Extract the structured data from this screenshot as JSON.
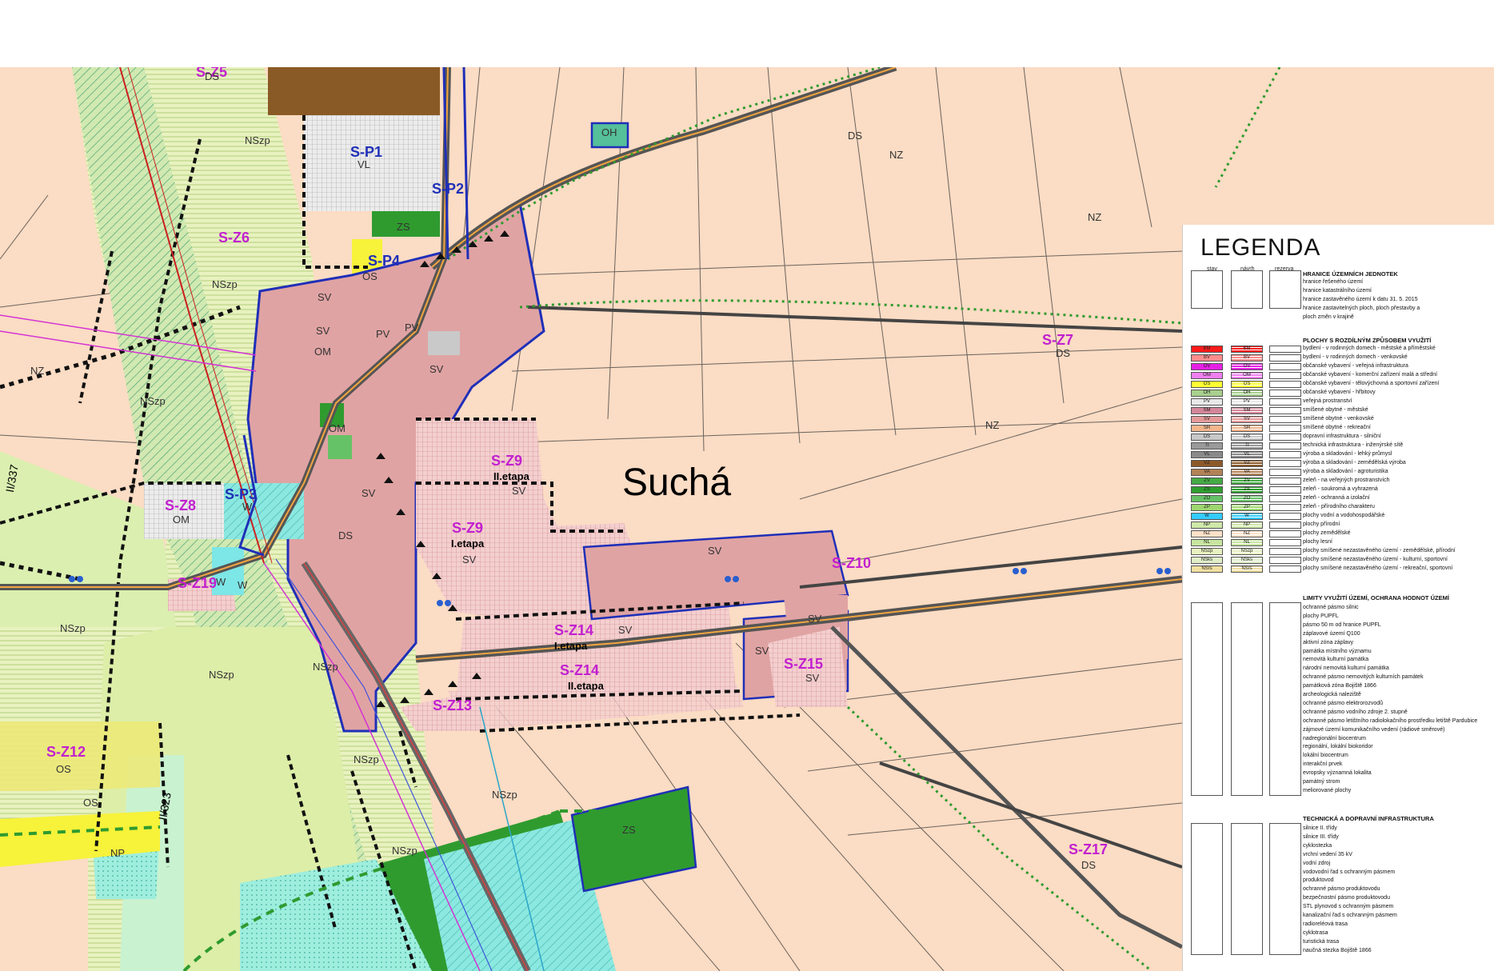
{
  "map": {
    "village_name": "Suchá",
    "zone_labels": [
      {
        "id": "s-z5",
        "text": "S-Z5",
        "style": "zone-id"
      },
      {
        "id": "s-p1",
        "text": "S-P1",
        "style": "zone-id-blue"
      },
      {
        "id": "s-p2",
        "text": "S-P2",
        "style": "zone-id-blue"
      },
      {
        "id": "s-z6",
        "text": "S-Z6",
        "style": "zone-id"
      },
      {
        "id": "s-p4",
        "text": "S-P4",
        "style": "zone-id-blue"
      },
      {
        "id": "s-z7",
        "text": "S-Z7",
        "style": "zone-id"
      },
      {
        "id": "s-z9-ii",
        "text": "S-Z9",
        "style": "zone-id"
      },
      {
        "id": "s-z9-i",
        "text": "S-Z9",
        "style": "zone-id"
      },
      {
        "id": "s-z8",
        "text": "S-Z8",
        "style": "zone-id"
      },
      {
        "id": "s-p3",
        "text": "S-P3",
        "style": "zone-id-blue"
      },
      {
        "id": "s-z10",
        "text": "S-Z10",
        "style": "zone-id"
      },
      {
        "id": "s-z19",
        "text": "S-Z19",
        "style": "zone-id"
      },
      {
        "id": "s-z14-i",
        "text": "S-Z14",
        "style": "zone-id"
      },
      {
        "id": "s-z14-ii",
        "text": "S-Z14",
        "style": "zone-id"
      },
      {
        "id": "s-z15",
        "text": "S-Z15",
        "style": "zone-id"
      },
      {
        "id": "s-z13",
        "text": "S-Z13",
        "style": "zone-id"
      },
      {
        "id": "s-z12",
        "text": "S-Z12",
        "style": "zone-id"
      },
      {
        "id": "s-z17",
        "text": "S-Z17",
        "style": "zone-id"
      }
    ],
    "etapa_labels": [
      {
        "id": "etapa-z9-ii",
        "text": "II.etapa"
      },
      {
        "id": "etapa-z9-i",
        "text": "I.etapa"
      },
      {
        "id": "etapa-z14-i",
        "text": "I.etapa"
      },
      {
        "id": "etapa-z14-ii",
        "text": "II.etapa"
      }
    ],
    "code_labels": [
      "DS",
      "NSzp",
      "VL",
      "ZS",
      "OS",
      "SV",
      "OM",
      "NZ",
      "PV",
      "W",
      "NP",
      "OH",
      "DS",
      "SV",
      "SV",
      "SV",
      "SV",
      "SV",
      "SV",
      "SV",
      "SV",
      "SV",
      "SV",
      "NSzp",
      "NSzp",
      "NSzp",
      "NSzp",
      "NSzp",
      "NSzp",
      "NSzp",
      "NSzp",
      "OS",
      "OS",
      "NZ",
      "NZ",
      "NZ",
      "ZS",
      "DS",
      "DS",
      "DS",
      "W",
      "W",
      "OM",
      "OM",
      "PV"
    ],
    "road_labels": [
      "II/323",
      "II/337"
    ]
  },
  "legend": {
    "title": "LEGENDA",
    "col_headers": [
      "stav",
      "návrh",
      "rezerva"
    ],
    "sections": [
      {
        "heading": "HRANICE ÚZEMNÍCH JEDNOTEK",
        "items": [
          "hranice řešeného území",
          "hranice katastrálního území",
          "hranice zastavěného území k datu 31. 5. 2015",
          "hranice zastavitelných ploch, ploch přestavby a",
          "ploch změn v krajině"
        ]
      },
      {
        "heading": "PLOCHY S ROZDÍLNÝM ZPŮSOBEM VYUŽITÍ",
        "items": [
          "bydlení - v rodinných domech - městské a příměstské",
          "bydlení - v rodinných domech - venkovské",
          "občanské vybavení - veřejná infrastruktura",
          "občanské vybavení - komerční zařízení malá a střední",
          "občanské vybavení - tělovýchovná a sportovní zařízení",
          "občanské vybavení - hřbitovy",
          "veřejná prostranství",
          "smíšené obytné - městské",
          "smíšené obytné - venkovské",
          "smíšené obytné - rekreační",
          "dopravní infrastruktura - silniční",
          "technická infrastruktura - inženýrské sítě",
          "výroba a skladování - lehký průmysl",
          "výroba a skladování - zemědělská výroba",
          "výroba a skladování - agroturistika",
          "zeleň - na veřejných prostranstvích",
          "zeleň - soukromá a vyhrazená",
          "zeleň - ochranná a izolační",
          "zeleň - přírodního charakteru",
          "plochy vodní a vodohospodářské",
          "plochy přírodní",
          "plochy zemědělské",
          "plochy lesní",
          "plochy smíšené nezastavěného území - zemědělské, přírodní",
          "plochy smíšené nezastavěného území - kulturní, sportovní",
          "plochy smíšené nezastavěného území - rekreační, sportovní"
        ],
        "stav_codes": [
          "BM",
          "BV",
          "OV",
          "OM",
          "OS",
          "OH",
          "PV",
          "SM",
          "SV",
          "SR",
          "DS",
          "TI",
          "VL",
          "VZ",
          "VA",
          "ZV",
          "ZS",
          "ZO",
          "ZP",
          "W",
          "NP",
          "NZ",
          "NL",
          "NSzp",
          "NSks",
          "NSrs"
        ],
        "stav_colors": [
          "#ff1a1a",
          "#ff8c8c",
          "#e61ee6",
          "#f07ff0",
          "#ffff33",
          "#a8d08d",
          "#e8e8e8",
          "#d4869a",
          "#e59a9a",
          "#f3b58c",
          "#c8c8c8",
          "#9a9a9a",
          "#8a8a8a",
          "#8c5a2a",
          "#b38256",
          "#44aa44",
          "#2e9e2e",
          "#66c266",
          "#9fd66f",
          "#33ccff",
          "#cfe8a9",
          "#fde0c8",
          "#c8e6a0",
          "#e8f2c0",
          "#e0eec8",
          "#f0e0a0"
        ]
      },
      {
        "heading": "LIMITY VYUŽITÍ ÚZEMÍ, OCHRANA HODNOT ÚZEMÍ",
        "items": [
          "ochranné pásmo silnic",
          "plochy PUPFL",
          "pásmo 50 m od hranice PUPFL",
          "záplavové území Q100",
          "aktivní zóna záplavy",
          "památka místního významu",
          "nemovitá kulturní památka",
          "národní nemovitá kulturní památka",
          "ochranné pásmo nemovitých kulturních památek",
          "památková zóna Bojiště 1866",
          "archeologická naleziště",
          "ochranné pásmo elektrorozvodů",
          "ochranné pásmo vodního zdroje 2. stupně",
          "ochranné pásmo letištního radiolokačního prostředku letiště Pardubice",
          "zájmové území komunikačního vedení (rádiové směrové)",
          "nadregionální biocentrum",
          "regionální, lokální biokoridor",
          "lokální biocentrum",
          "interakční prvek",
          "evropsky významná lokalita",
          "památný strom",
          "meliorované plochy"
        ]
      },
      {
        "heading": "TECHNICKÁ A DOPRAVNÍ INFRASTRUKTURA",
        "items": [
          "silnice II. třídy",
          "silnice III. třídy",
          "cyklostezka",
          "vrchní vedení 35 kV",
          "vodní zdroj",
          "vodovodní řad s ochranným pásmem",
          "produktovod",
          "ochranné pásmo produktovodu",
          "bezpečnostní pásmo produktovodu",
          "STL plynovod s ochranným pásmem",
          "kanalizační řad s ochranným pásmem",
          "radioreléová trasa",
          "cyklotrasa",
          "turistická trasa",
          "naučná stezka Bojiště 1866"
        ]
      }
    ]
  },
  "colors": {
    "background": "#fbdcc4",
    "sv_zone": "#e0a3a3",
    "nszp": "#e5f3b9",
    "forest_green": "#2f9b2f",
    "water_cyan": "#74e5e5",
    "yellow_os": "#f7f23a",
    "brown_vz": "#8a5a26",
    "gray_vl": "#c9c9c9",
    "magenta": "#c21fd0",
    "blue": "#1f2fb8",
    "orange_road": "#f2a541"
  }
}
